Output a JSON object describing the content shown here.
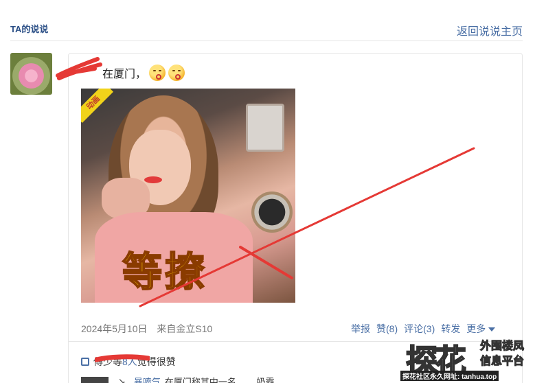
{
  "header": {
    "title": "TA的说说",
    "back_link": "返回说说主页"
  },
  "post": {
    "text": "在厦门，",
    "emojis": [
      "kissing-face-icon",
      "kissing-face-icon"
    ],
    "image": {
      "badge": "动画",
      "caption": "等撩"
    },
    "date": "2024年5月10日",
    "source": "来自金立S10",
    "actions": {
      "report": "举报",
      "like": "赞(8)",
      "comment": "评论(3)",
      "share": "转发",
      "more": "更多"
    }
  },
  "likes": {
    "masked_names": "傅少",
    "suffix_prefix": "等",
    "count": "8人",
    "suffix": "觉得很赞"
  },
  "comment": {
    "name": "暴喷气",
    "text": "在厦门称其中一名…… 奶霸"
  },
  "watermark": {
    "big": "探花",
    "line1": "外围楼凤",
    "line2": "信息平台",
    "footer": "探花社区永久网址: tanhua.top"
  },
  "colors": {
    "link": "#4a6fa5",
    "title": "#2b4f86",
    "scribble": "#e53935"
  }
}
